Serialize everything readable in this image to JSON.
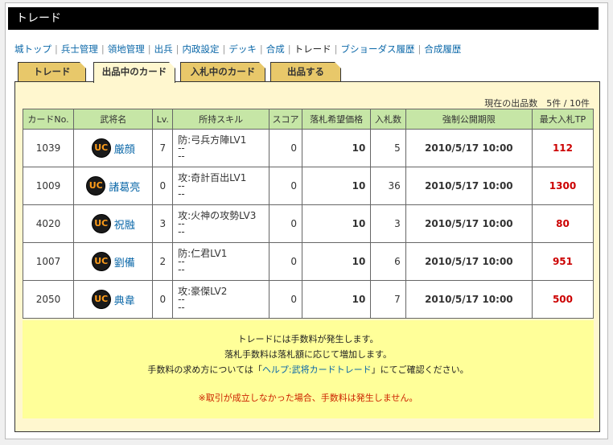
{
  "title": "トレード",
  "nav": [
    {
      "label": "城トップ",
      "current": false
    },
    {
      "label": "兵士管理",
      "current": false
    },
    {
      "label": "領地管理",
      "current": false
    },
    {
      "label": "出兵",
      "current": false
    },
    {
      "label": "内政設定",
      "current": false
    },
    {
      "label": "デッキ",
      "current": false
    },
    {
      "label": "合成",
      "current": false
    },
    {
      "label": "トレード",
      "current": true
    },
    {
      "label": "ブショーダス履歴",
      "current": false
    },
    {
      "label": "合成履歴",
      "current": false
    }
  ],
  "tabs": [
    {
      "label": "トレード",
      "active": false
    },
    {
      "label": "出品中のカード",
      "active": true
    },
    {
      "label": "入札中のカード",
      "active": false
    },
    {
      "label": "出品する",
      "active": false
    }
  ],
  "listing_count": "現在の出品数　5件 / 10件",
  "table": {
    "headers": [
      "カードNo.",
      "武将名",
      "Lv.",
      "所持スキル",
      "スコア",
      "落札希望価格",
      "入札数",
      "強制公開期限",
      "最大入札TP"
    ],
    "badge": "UC",
    "rows": [
      {
        "no": "1039",
        "name": "厳顔",
        "lv": "7",
        "skills": [
          "防:弓兵方陣LV1",
          "--",
          "--"
        ],
        "score": "0",
        "price": "10",
        "bids": "5",
        "deadline": "2010/5/17 10:00",
        "max_tp": "112"
      },
      {
        "no": "1009",
        "name": "諸葛亮",
        "lv": "0",
        "skills": [
          "攻:奇計百出LV1",
          "--",
          "--"
        ],
        "score": "0",
        "price": "10",
        "bids": "36",
        "deadline": "2010/5/17 10:00",
        "max_tp": "1300"
      },
      {
        "no": "4020",
        "name": "祝融",
        "lv": "3",
        "skills": [
          "攻:火神の攻勢LV3",
          "--",
          "--"
        ],
        "score": "0",
        "price": "10",
        "bids": "3",
        "deadline": "2010/5/17 10:00",
        "max_tp": "80"
      },
      {
        "no": "1007",
        "name": "劉備",
        "lv": "2",
        "skills": [
          "防:仁君LV1",
          "--",
          "--"
        ],
        "score": "0",
        "price": "10",
        "bids": "6",
        "deadline": "2010/5/17 10:00",
        "max_tp": "951"
      },
      {
        "no": "2050",
        "name": "典韋",
        "lv": "0",
        "skills": [
          "攻:豪傑LV2",
          "--",
          "--"
        ],
        "score": "0",
        "price": "10",
        "bids": "7",
        "deadline": "2010/5/17 10:00",
        "max_tp": "500"
      }
    ]
  },
  "notice": {
    "line1": "トレードには手数料が発生します。",
    "line2": "落札手数料は落札額に応じて増加します。",
    "line3_pre": "手数料の求め方については「",
    "line3_link": "ヘルプ:武将カードトレード",
    "line3_post": "」にてご確認ください。",
    "warning": "※取引が成立しなかった場合、手数料は発生しません。"
  }
}
